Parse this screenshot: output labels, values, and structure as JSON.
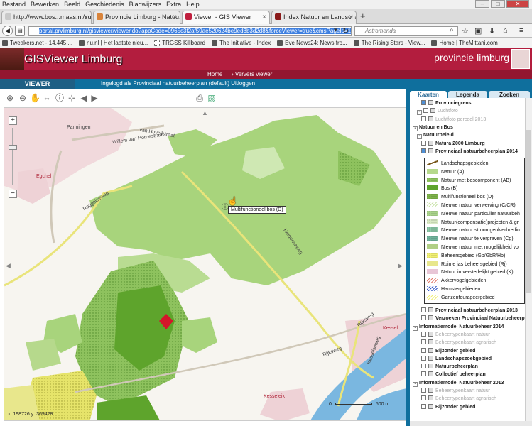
{
  "browser": {
    "menu": [
      "Bestand",
      "Bewerken",
      "Beeld",
      "Geschiedenis",
      "Bladwijzers",
      "Extra",
      "Help"
    ],
    "tabs": [
      {
        "label": "http://www.bos...maas.nl/subinl",
        "color": "#c9c9c9"
      },
      {
        "label": "Provincie Limburg - Natuu...",
        "color": "#d9843b"
      },
      {
        "label": "Viewer - GIS Viewer",
        "color": "#c01f3e"
      },
      {
        "label": "Index Natuur en Landscha...",
        "color": "#8a1a1a"
      }
    ],
    "url": "portal.prvlimburg.nl/gisviewer/viewer.do?appCode=0965c3f2af59ae520624be9ed3b3d2d8&forceViewer=true&cmsPageId=1#",
    "search_placeholder": "Astromenda",
    "bookmarks": [
      "Tweakers.net - 14.445 ...",
      "nu.nl | Het laatste nieu...",
      "TRGSS Killboard",
      "The Initiative - Index",
      "Eve News24: News fro...",
      "The Rising Stars - View...",
      "Home | TheMittani.com"
    ]
  },
  "site": {
    "title": "GISViewer Limburg",
    "province": "provincie limburg",
    "nav": [
      "Home",
      "› Ververs viewer"
    ],
    "viewer_label": "VIEWER",
    "login_info": "Ingelogd als Provinciaal natuurbeheerplan (default) Uitloggen"
  },
  "panel": {
    "tabs": [
      "Kaarten",
      "Legenda",
      "Zoeken"
    ],
    "tree": [
      {
        "label": "Provinciegrens",
        "indent": 2,
        "checked": true,
        "dim": false,
        "expander": ""
      },
      {
        "label": "Luchtfoto",
        "indent": 1,
        "checked": false,
        "dim": true,
        "expander": "-"
      },
      {
        "label": "Luchtfoto perceel 2013",
        "indent": 2,
        "checked": false,
        "dim": true,
        "expander": ""
      },
      {
        "label": "Natuur en Bos",
        "indent": 0,
        "checked": null,
        "dim": false,
        "expander": "-"
      },
      {
        "label": "Natuurbeleid",
        "indent": 1,
        "checked": null,
        "dim": false,
        "expander": "-"
      },
      {
        "label": "Natura 2000 Limburg",
        "indent": 2,
        "checked": false,
        "dim": false,
        "expander": ""
      },
      {
        "label": "Provinciaal natuurbeheerplan 2014",
        "indent": 2,
        "checked": true,
        "dim": false,
        "expander": ""
      }
    ],
    "tree2": [
      {
        "label": "Provinciaal natuurbeheerplan 2013",
        "indent": 2,
        "checked": false,
        "dim": false,
        "expander": ""
      },
      {
        "label": "Verzoeken Provinciaal Natuurbeheerplan",
        "indent": 2,
        "checked": false,
        "dim": false,
        "expander": ""
      },
      {
        "label": "Informatiemodel Natuurbeheer 2014",
        "indent": 0,
        "checked": null,
        "dim": false,
        "expander": "-"
      },
      {
        "label": "Beheertypenkaart natuur",
        "indent": 2,
        "checked": false,
        "dim": true,
        "expander": ""
      },
      {
        "label": "Beheertypenkaart agrarisch",
        "indent": 2,
        "checked": false,
        "dim": true,
        "expander": ""
      },
      {
        "label": "Bijzonder gebied",
        "indent": 2,
        "checked": false,
        "dim": false,
        "expander": ""
      },
      {
        "label": "Landschapszoekgebied",
        "indent": 2,
        "checked": false,
        "dim": false,
        "expander": ""
      },
      {
        "label": "Natuurbeheerplan",
        "indent": 2,
        "checked": false,
        "dim": false,
        "expander": ""
      },
      {
        "label": "Collectief beheerplan",
        "indent": 2,
        "checked": false,
        "dim": false,
        "expander": ""
      },
      {
        "label": "Informatiemodel Natuurbeheer 2013",
        "indent": 0,
        "checked": null,
        "dim": false,
        "expander": "-"
      },
      {
        "label": "Beheertypenkaart natuur",
        "indent": 2,
        "checked": false,
        "dim": true,
        "expander": ""
      },
      {
        "label": "Beheertypenkaart agrarisch",
        "indent": 2,
        "checked": false,
        "dim": true,
        "expander": ""
      },
      {
        "label": "Bijzonder gebied",
        "indent": 2,
        "checked": false,
        "dim": false,
        "expander": ""
      }
    ],
    "legend": [
      {
        "label": "Landschapsgebieden",
        "color": "#7a5a1e",
        "style": "line"
      },
      {
        "label": "Natuur (A)",
        "color": "#b6d98c",
        "style": "fill"
      },
      {
        "label": "Natuur met boscomponent (AB)",
        "color": "#8ec25e",
        "style": "dots"
      },
      {
        "label": "Bos (B)",
        "color": "#5ea42c",
        "style": "fill"
      },
      {
        "label": "Multifunctioneel bos (D)",
        "color": "#7db24a",
        "style": "dots"
      },
      {
        "label": "Nieuwe natuur verwerving (C/CR)",
        "color": "#c9e3a8",
        "style": "hatch"
      },
      {
        "label": "Nieuwe natuur particulier natuurbeh",
        "color": "#a9d38b",
        "style": "dots"
      },
      {
        "label": "Natuur(compensatie)projecten & gr",
        "color": "#d9e9c4",
        "style": "dots"
      },
      {
        "label": "Nieuwe natuur stroomgeulverbredin",
        "color": "#8cc9a8",
        "style": "dots"
      },
      {
        "label": "Nieuwe natuur te vergraven (Cg)",
        "color": "#6fb29b",
        "style": "dots"
      },
      {
        "label": "Nieuwe natuur met mogelijkheid vo",
        "color": "#b0cf85",
        "style": "fill"
      },
      {
        "label": "Beheersgebied (Gb/GbR/Hb)",
        "color": "#f0ef73",
        "style": "dots"
      },
      {
        "label": "Ruime jas beheersgebied (Rj)",
        "color": "#e8e78c",
        "style": "fill"
      },
      {
        "label": "Natuur in verstedelijkt gebied (K)",
        "color": "#e8c6d6",
        "style": "fill"
      },
      {
        "label": "Akkervogelgebieden",
        "color": "#e07a6a",
        "style": "hatch"
      },
      {
        "label": "Hamstergebieden",
        "color": "#3a5fc9",
        "style": "hatch"
      },
      {
        "label": "Ganzenfourageergebied",
        "color": "#f0ef73",
        "style": "hatch"
      }
    ]
  },
  "map": {
    "tooltip": "Multifunctioneel bos (D)",
    "coords": "x: 198726  y: 369428",
    "scale_label_left": "0",
    "scale_label_right": "500 m",
    "place_labels": [
      {
        "text": "Panningen",
        "color": "#444"
      },
      {
        "text": "Willem van Hornestraat",
        "color": "#444"
      },
      {
        "text": "van Hovellstraat",
        "color": "#444"
      },
      {
        "text": "Egchel",
        "color": "#b0283b"
      },
      {
        "text": "Roggelseweg",
        "color": "#444"
      },
      {
        "text": "Helden­seweg",
        "color": "#444"
      },
      {
        "text": "Kessel",
        "color": "#b0283b"
      },
      {
        "text": "Rijksweg",
        "color": "#444"
      },
      {
        "text": "Kesselseweg",
        "color": "#444"
      },
      {
        "text": "Kesseleik",
        "color": "#b0283b"
      },
      {
        "text": "Rijksweg",
        "color": "#444"
      }
    ]
  }
}
